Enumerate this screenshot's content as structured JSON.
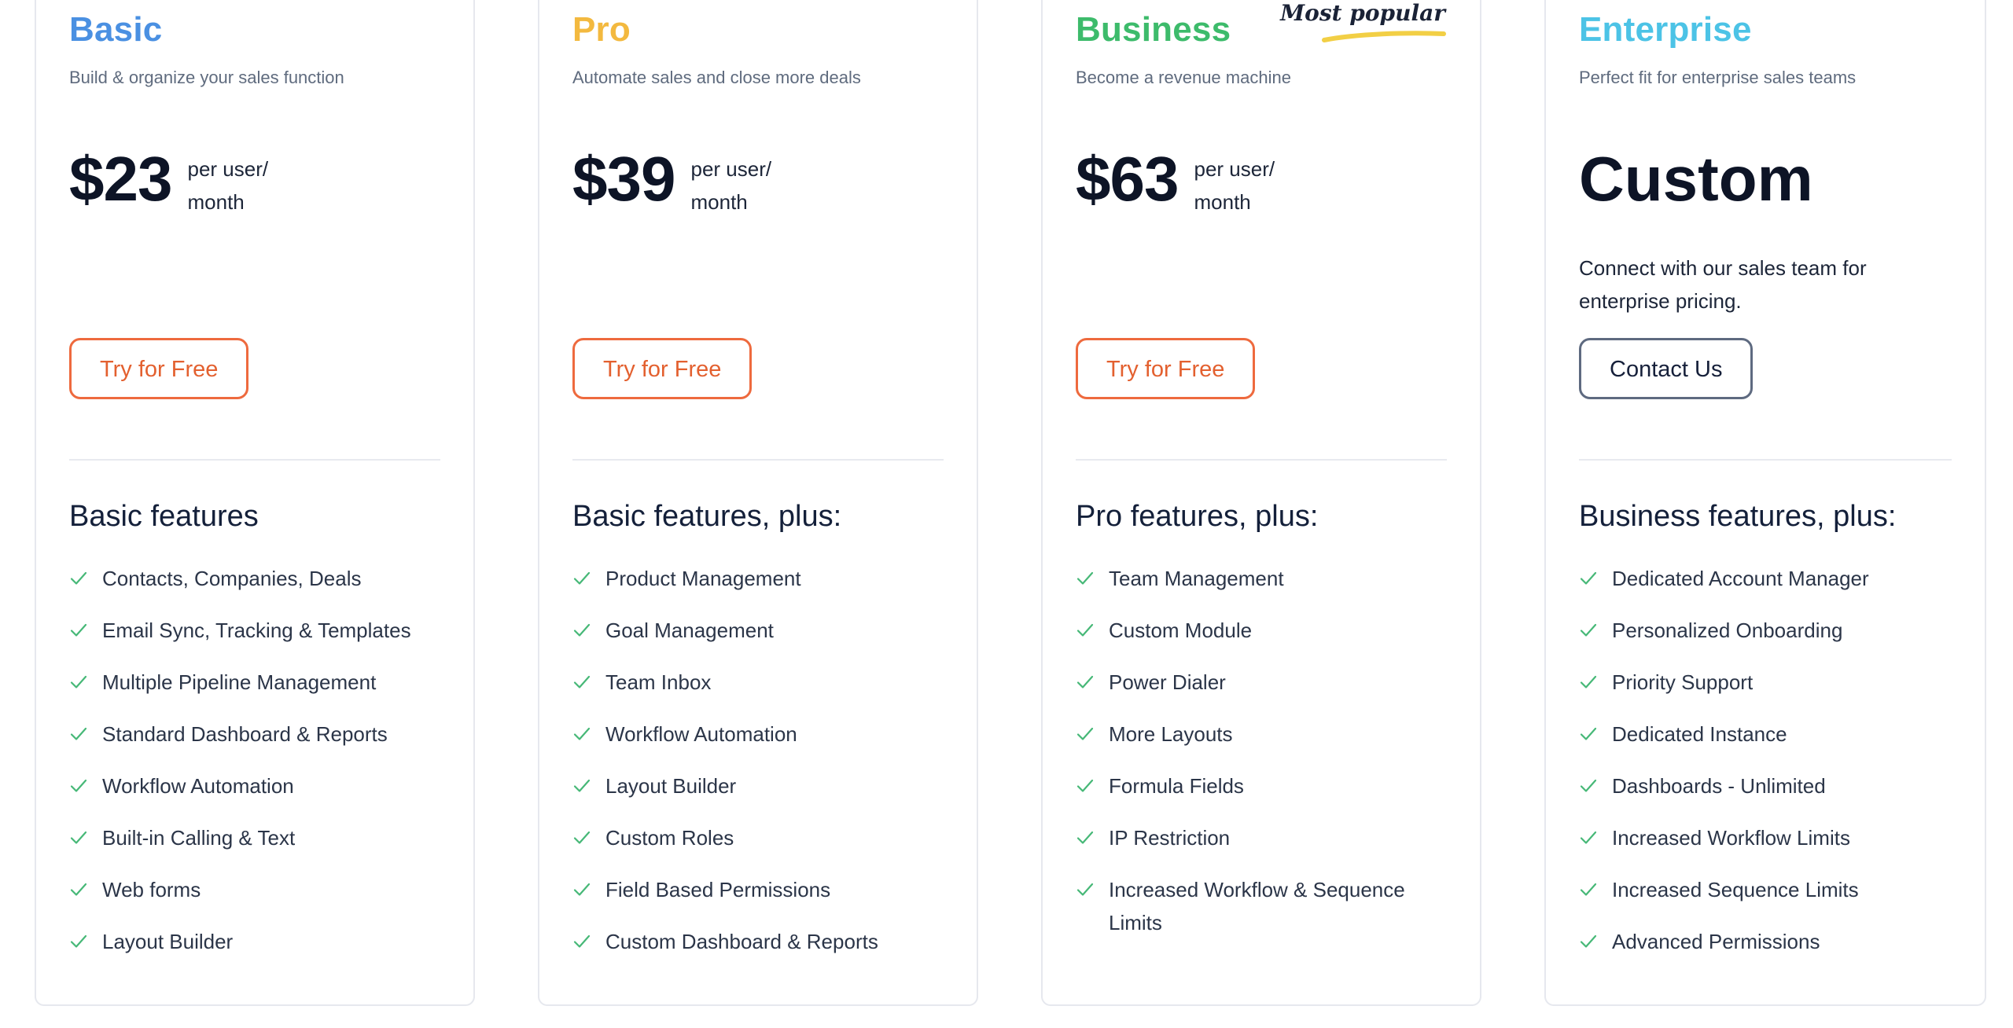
{
  "colors": {
    "basic": "#4a90e2",
    "pro": "#f3b93f",
    "business": "#3dbb6b",
    "enterprise": "#4cc3e6",
    "cta_orange": "#ee6a3e",
    "check_green": "#46b877"
  },
  "plans": [
    {
      "name": "Basic",
      "tagline": "Build & organize your sales function",
      "price": "$23",
      "price_unit": "per user/ month",
      "cta": "Try for Free",
      "features_heading": "Basic features",
      "features": [
        "Contacts, Companies, Deals",
        "Email Sync, Tracking & Templates",
        "Multiple Pipeline Management",
        "Standard Dashboard & Reports",
        "Workflow Automation",
        "Built-in Calling & Text",
        "Web forms",
        "Layout Builder"
      ]
    },
    {
      "name": "Pro",
      "tagline": "Automate sales and close more deals",
      "price": "$39",
      "price_unit": "per user/ month",
      "cta": "Try for Free",
      "features_heading": "Basic features, plus:",
      "features": [
        "Product Management",
        "Goal Management",
        "Team Inbox",
        "Workflow Automation",
        "Layout Builder",
        "Custom Roles",
        "Field Based Permissions",
        "Custom Dashboard & Reports"
      ]
    },
    {
      "name": "Business",
      "badge": "Most popular",
      "tagline": "Become a revenue machine",
      "price": "$63",
      "price_unit": "per user/ month",
      "cta": "Try for Free",
      "features_heading": "Pro features, plus:",
      "features": [
        "Team Management",
        "Custom Module",
        "Power Dialer",
        "More Layouts",
        "Formula Fields",
        "IP Restriction",
        "Increased Workflow & Sequence Limits"
      ]
    },
    {
      "name": "Enterprise",
      "tagline": "Perfect fit for enterprise sales teams",
      "price": "Custom",
      "note": "Connect with our sales team for enterprise pricing.",
      "cta": "Contact Us",
      "features_heading": "Business features, plus:",
      "features": [
        "Dedicated Account Manager",
        "Personalized Onboarding",
        "Priority Support",
        "Dedicated Instance",
        "Dashboards - Unlimited",
        "Increased Workflow Limits",
        "Increased Sequence Limits",
        "Advanced Permissions"
      ]
    }
  ]
}
